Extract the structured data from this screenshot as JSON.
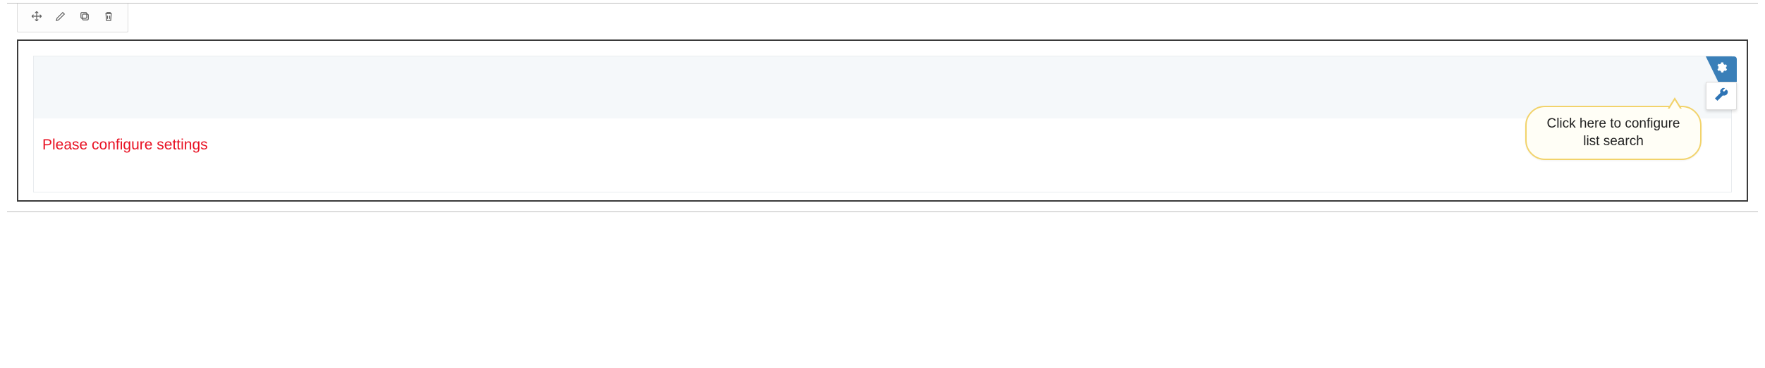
{
  "toolbar": {
    "move_label": "Move",
    "edit_label": "Edit",
    "copy_label": "Copy",
    "delete_label": "Delete"
  },
  "panel": {
    "warning_text": "Please configure settings",
    "tooltip_text": "Click here to configure list search"
  }
}
